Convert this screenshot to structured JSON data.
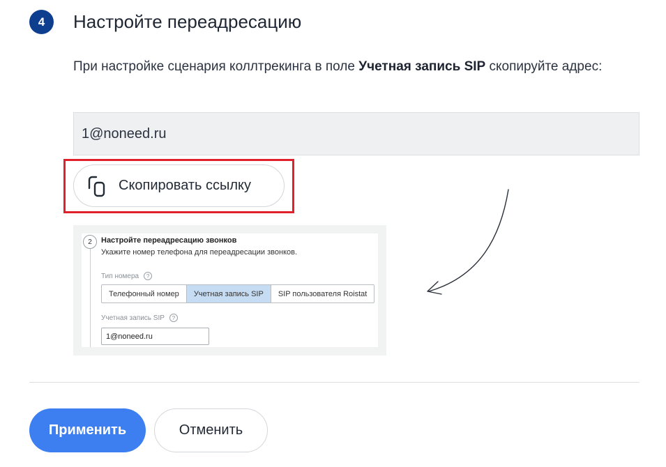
{
  "step": {
    "number": "4",
    "title": "Настройте переадресацию"
  },
  "instruction": {
    "before": "При настройке сценария коллтрекинга в поле ",
    "bold": "Учетная запись SIP",
    "after": " скопируйте адрес:"
  },
  "sip_field": {
    "value": "1@noneed.ru"
  },
  "copy_button": {
    "label": "Скопировать ссылку",
    "icon": "copy-icon"
  },
  "colors": {
    "badge": "#0e3f8f",
    "highlight": "#e0202a",
    "primary": "#3d7ff0",
    "segment_active": "#c5dcf3"
  },
  "example_screenshot": {
    "step_number": "2",
    "title": "Настройте переадресацию звонков",
    "subtitle": "Укажите номер телефона для переадресации звонков.",
    "number_type_label": "Тип номера",
    "number_type_options": [
      "Телефонный номер",
      "Учетная запись SIP",
      "SIP пользователя Roistat"
    ],
    "number_type_selected": "Учетная запись SIP",
    "sip_label": "Учетная запись SIP",
    "sip_value": "1@noneed.ru",
    "help_icon": "question-icon"
  },
  "actions": {
    "apply_label": "Применить",
    "cancel_label": "Отменить"
  }
}
